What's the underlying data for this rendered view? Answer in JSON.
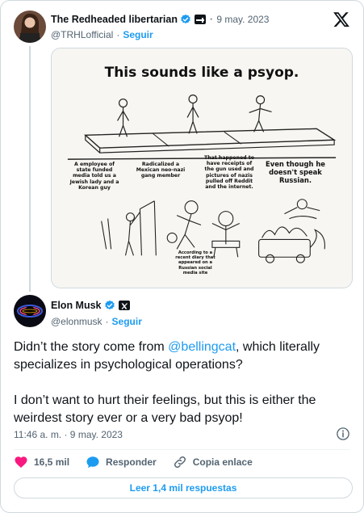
{
  "quoted": {
    "display_name": "The Redheaded libertarian",
    "handle": "@TRHLofficial",
    "date": "9 may. 2023",
    "follow_label": "Seguir",
    "separator": "·"
  },
  "comic": {
    "title": "This sounds like a psyop.",
    "captions": [
      "A employee of state funded media told us a Jewish lady and a Korean guy",
      "Radicalized a Mexican neo-nazi gang member",
      "That happened to have receipts of the gun used and pictures of nazis pulled off Reddit and the internet.",
      "Even though he doesn't speak Russian.",
      "According to a recent diary that appeared on a Russian social media site"
    ]
  },
  "tweet": {
    "display_name": "Elon Musk",
    "handle": "@elonmusk",
    "follow_label": "Seguir",
    "separator": "·",
    "text_part1": "Didn’t the story come from ",
    "mention": "@bellingcat",
    "text_part2": ", which literally specializes in psychological operations?",
    "text_para2": "I don’t want to hurt their feelings, but this is either the weirdest story ever or a very bad psyop!",
    "timestamp": "11:46 a. m. · 9 may. 2023"
  },
  "actions": {
    "likes": "16,5 mil",
    "reply_label": "Responder",
    "copy_label": "Copia enlace"
  },
  "replies_button": "Leer 1,4 mil respuestas",
  "colors": {
    "accent": "#1d9bf0",
    "like": "#f91880",
    "text": "#0f1419",
    "muted": "#536471",
    "border": "#cfd9de"
  },
  "icons": [
    "x-logo-icon",
    "verified-badge-icon",
    "affiliate-badge-icon",
    "heart-icon",
    "reply-icon",
    "link-icon",
    "info-icon"
  ]
}
